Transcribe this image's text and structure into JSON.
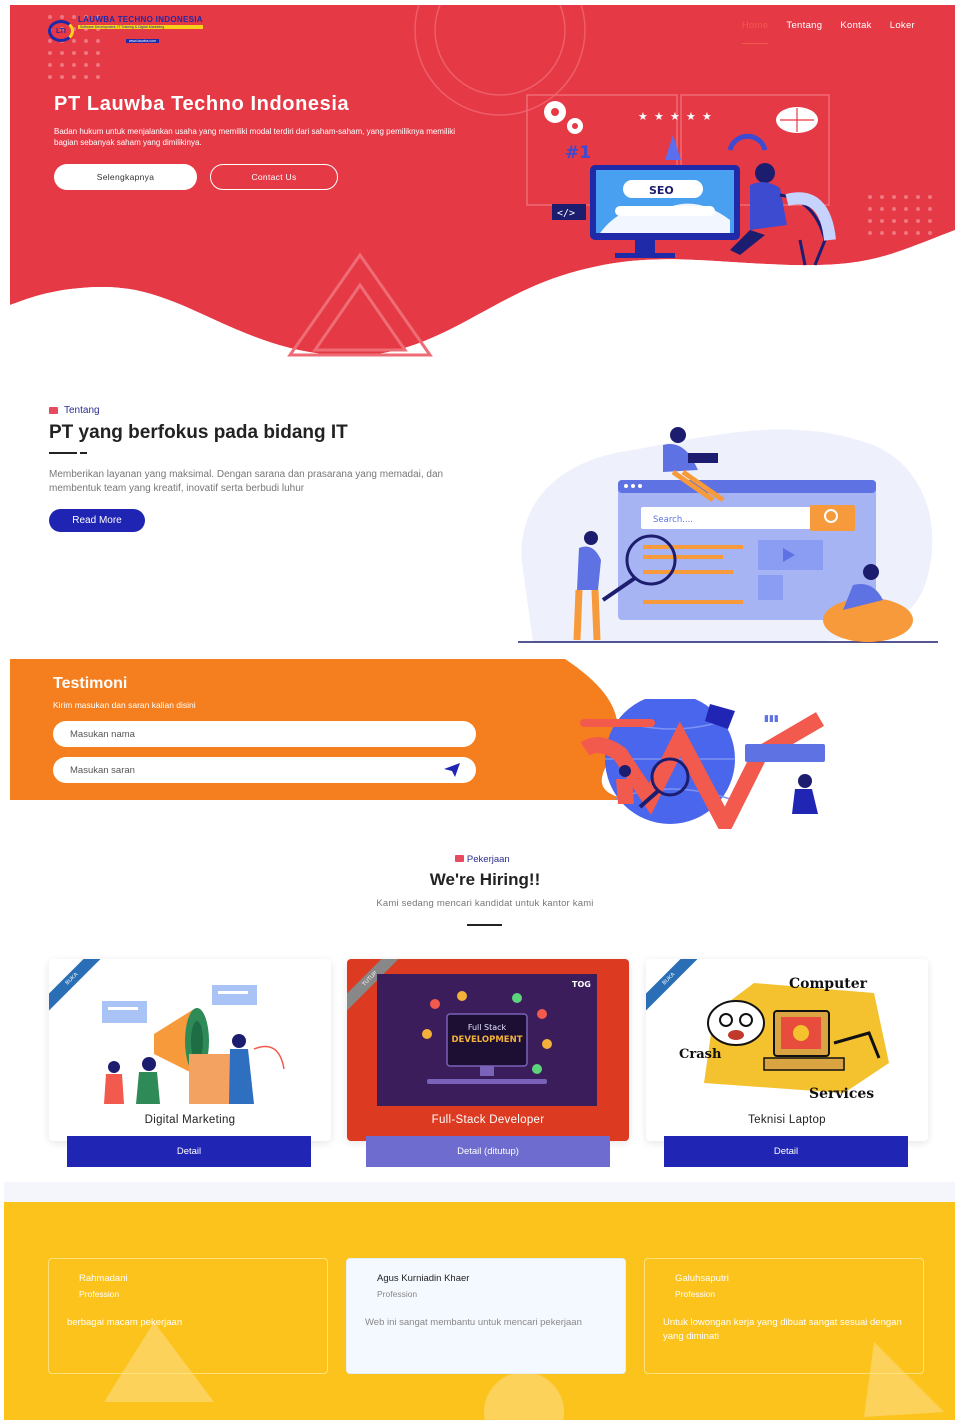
{
  "brand": {
    "logo_mark": "LTI",
    "name": "LAUWBA TECHNO INDONESIA",
    "tagline": "Software Development, IT Training & Digital Marketing",
    "url": "www.lauwba.com"
  },
  "nav": [
    {
      "label": "Home",
      "active": true
    },
    {
      "label": "Tentang",
      "active": false
    },
    {
      "label": "Kontak",
      "active": false
    },
    {
      "label": "Loker",
      "active": false
    }
  ],
  "hero": {
    "title": "PT Lauwba Techno Indonesia",
    "description": "Badan hukum untuk menjalankan usaha yang memiliki modal terdiri dari saham-saham, yang pemiliknya memiliki bagian sebanyak saham yang dimilikinya.",
    "primary_button": "Selengkapnya",
    "secondary_button": "Contact Us",
    "illustration": {
      "seo_label": "SEO",
      "rank_label": "#1",
      "code_label": "</>"
    }
  },
  "about": {
    "section_label": "Tentang",
    "title": "PT yang berfokus pada bidang IT",
    "description": "Memberikan layanan yang maksimal. Dengan sarana dan prasarana yang memadai, dan membentuk team yang kreatif, inovatif serta berbudi luhur",
    "button": "Read More",
    "search_placeholder": "Search...."
  },
  "testimoni": {
    "title": "Testimoni",
    "subtitle": "Kirim masukan dan saran kalian disini",
    "name_placeholder": "Masukan nama",
    "message_placeholder": "Masukan saran"
  },
  "hiring": {
    "section_label": "Pekerjaan",
    "title": "We're Hiring!!",
    "subtitle": "Kami sedang mencari kandidat untuk kantor kami",
    "jobs": [
      {
        "name": "Digital Marketing",
        "status": "BUKA",
        "button": "Detail",
        "closed": false
      },
      {
        "name": "Full-Stack Developer",
        "status": "TUTUP",
        "button": "Detail (ditutup)",
        "closed": true,
        "image_text": [
          "Full Stack",
          "DEVELOPMENT"
        ],
        "image_brand": "TOG"
      },
      {
        "name": "Teknisi Laptop",
        "status": "BUKA",
        "button": "Detail",
        "closed": false,
        "image_text": [
          "Computer",
          "Crash",
          "Services"
        ]
      }
    ]
  },
  "reviews": [
    {
      "name": "Rahmadani",
      "role": "Profession",
      "text": "berbagai macam pekerjaan",
      "active": false
    },
    {
      "name": "Agus Kurniadin Khaer",
      "role": "Profession",
      "text": "Web ini sangat membantu untuk mencari pekerjaan",
      "active": true
    },
    {
      "name": "Galuhsaputri",
      "role": "Profession",
      "text": "Untuk lowongan kerja yang dibuat sangat sesuai dengan yang diminati",
      "active": false
    }
  ],
  "colors": {
    "hero_red": "#e63946",
    "primary_blue": "#2125b3",
    "testi_orange": "#f57f1f",
    "review_yellow": "#fcc31d",
    "closed_red": "#dc3b22"
  }
}
